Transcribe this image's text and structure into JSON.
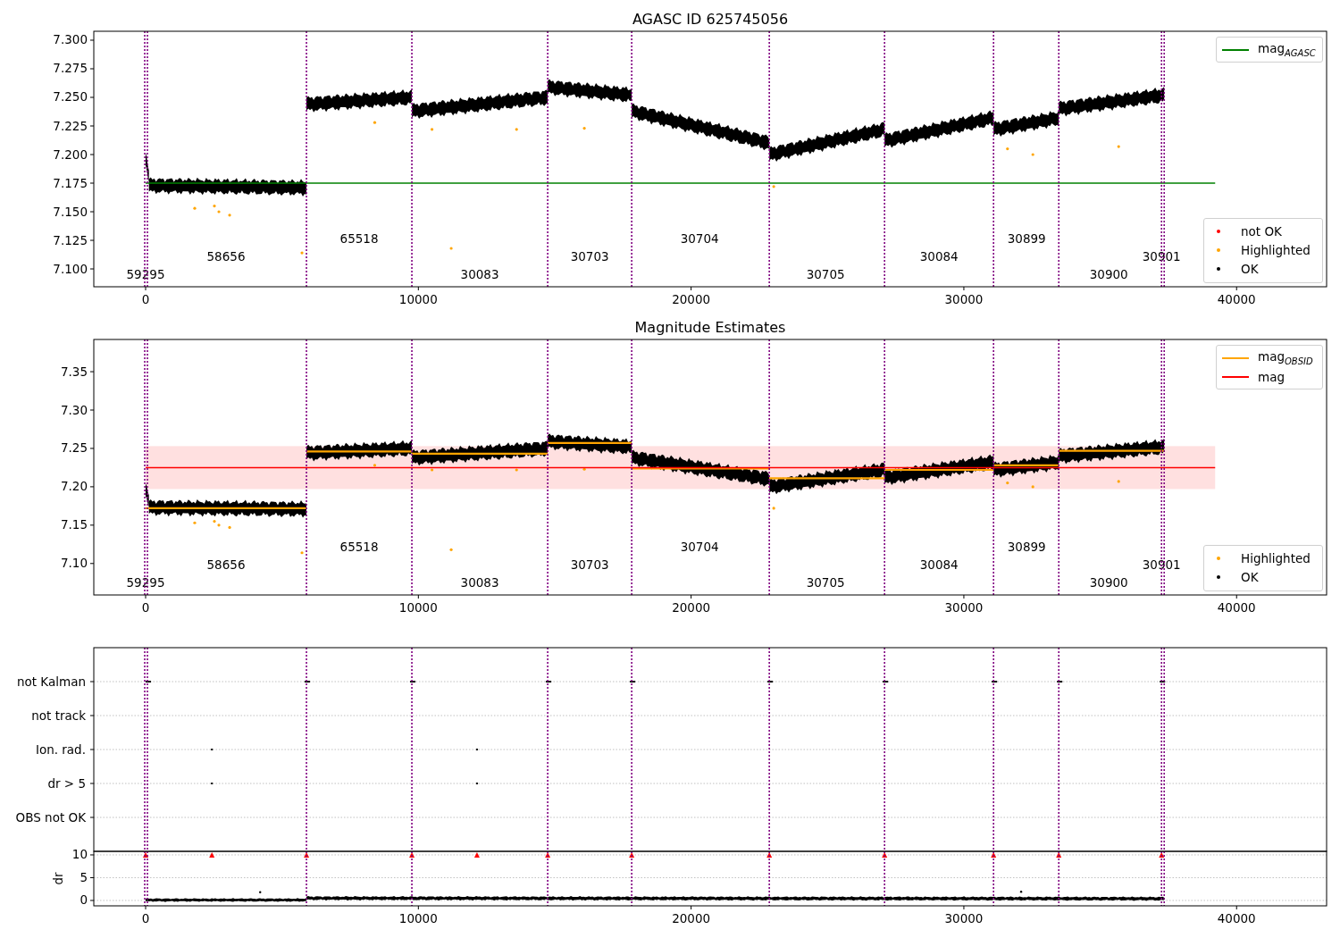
{
  "panels": [
    {
      "kind": "magnitude",
      "title": "AGASC ID 625745056",
      "y_tick_labels": [
        "7.300",
        "7.275",
        "7.250",
        "7.225",
        "7.200",
        "7.175",
        "7.150",
        "7.125",
        "7.100"
      ],
      "x_tick_labels": [
        "0",
        "10000",
        "20000",
        "30000",
        "40000"
      ],
      "obsid_labels": [
        "59295",
        "58656",
        "65518",
        "30083",
        "30703",
        "30704",
        "30705",
        "30084",
        "30899",
        "30900",
        "30901"
      ],
      "line_legend": [
        {
          "label": "mag$_{AGASC}$",
          "color": "#008000"
        }
      ],
      "marker_legend": [
        {
          "kind": "not_ok",
          "label": "not OK",
          "color": "#ff0000"
        },
        {
          "kind": "highlighted",
          "label": "Highlighted",
          "color": "#ffa500"
        },
        {
          "kind": "ok",
          "label": "OK",
          "color": "#000000"
        }
      ]
    },
    {
      "kind": "magnitude",
      "title": "Magnitude Estimates",
      "y_tick_labels": [
        "7.35",
        "7.30",
        "7.25",
        "7.20",
        "7.15",
        "7.10"
      ],
      "x_tick_labels": [
        "0",
        "10000",
        "20000",
        "30000",
        "40000"
      ],
      "obsid_labels": [
        "59295",
        "58656",
        "65518",
        "30083",
        "30703",
        "30704",
        "30705",
        "30084",
        "30899",
        "30900",
        "30901"
      ],
      "line_legend": [
        {
          "label": "mag$_{OBSID}$",
          "color": "#ffa500"
        },
        {
          "label": "mag",
          "color": "#ff0000"
        }
      ],
      "marker_legend": [
        {
          "kind": "highlighted",
          "label": "Highlighted",
          "color": "#ffa500"
        },
        {
          "kind": "ok",
          "label": "OK",
          "color": "#000000"
        }
      ]
    },
    {
      "kind": "flags",
      "flag_labels": [
        "not Kalman",
        "not track",
        "Ion. rad.",
        "dr > 5",
        "OBS not OK"
      ]
    },
    {
      "kind": "dr",
      "y_axis_label": "dr",
      "y_tick_labels": [
        "10",
        "5",
        "0"
      ],
      "x_tick_labels": [
        "0",
        "10000",
        "20000",
        "30000",
        "40000"
      ]
    }
  ]
}
